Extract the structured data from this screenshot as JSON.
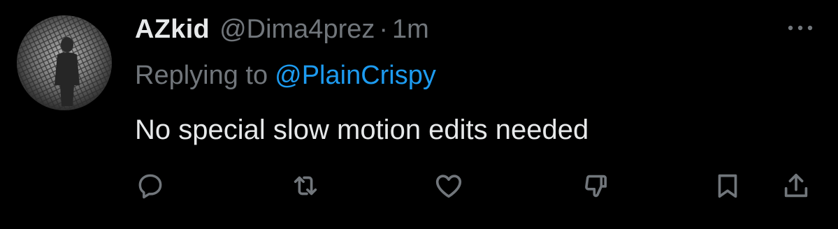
{
  "tweet": {
    "display_name": "AZkid",
    "handle": "@Dima4prez",
    "separator": "·",
    "timestamp": "1m",
    "replying_prefix": "Replying to",
    "replying_to": "@PlainCrispy",
    "text": "No special slow motion edits needed"
  },
  "actions": {
    "icons": [
      "reply-icon",
      "retweet-icon",
      "like-icon",
      "downvote-icon",
      "bookmark-icon",
      "share-icon"
    ]
  },
  "colors": {
    "background": "#000000",
    "primary_text": "#e7e9ea",
    "secondary_text": "#71767b",
    "link": "#1d9bf0"
  }
}
